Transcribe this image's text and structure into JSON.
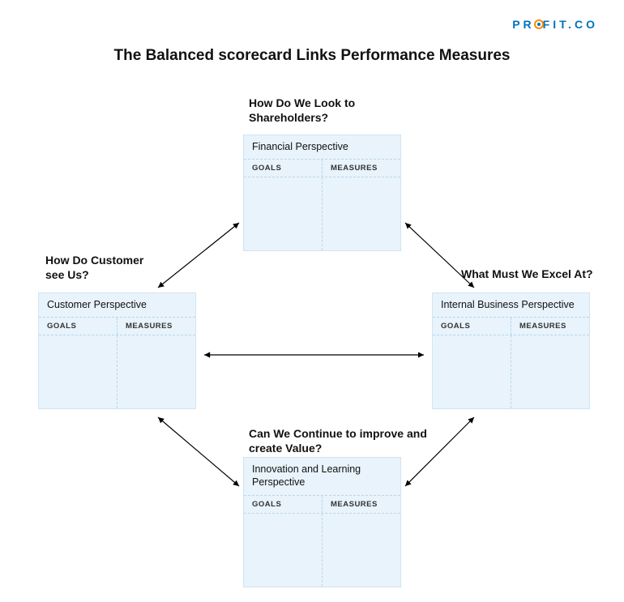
{
  "brand": {
    "name_pre": "PR",
    "name_post": "FIT.CO"
  },
  "title": "The Balanced scorecard Links Performance Measures",
  "columns": {
    "goals": "GOALS",
    "measures": "MEASURES"
  },
  "quadrants": {
    "top": {
      "question": "How Do We Look to Shareholders?",
      "title": "Financial Perspective"
    },
    "left": {
      "question": "How Do Customer see Us?",
      "title": "Customer Perspective"
    },
    "right": {
      "question": "What Must We Excel At?",
      "title": "Internal Business Perspective"
    },
    "bottom": {
      "question": "Can We Continue to improve and create Value?",
      "title": "Innovation and Learning Perspective"
    }
  }
}
